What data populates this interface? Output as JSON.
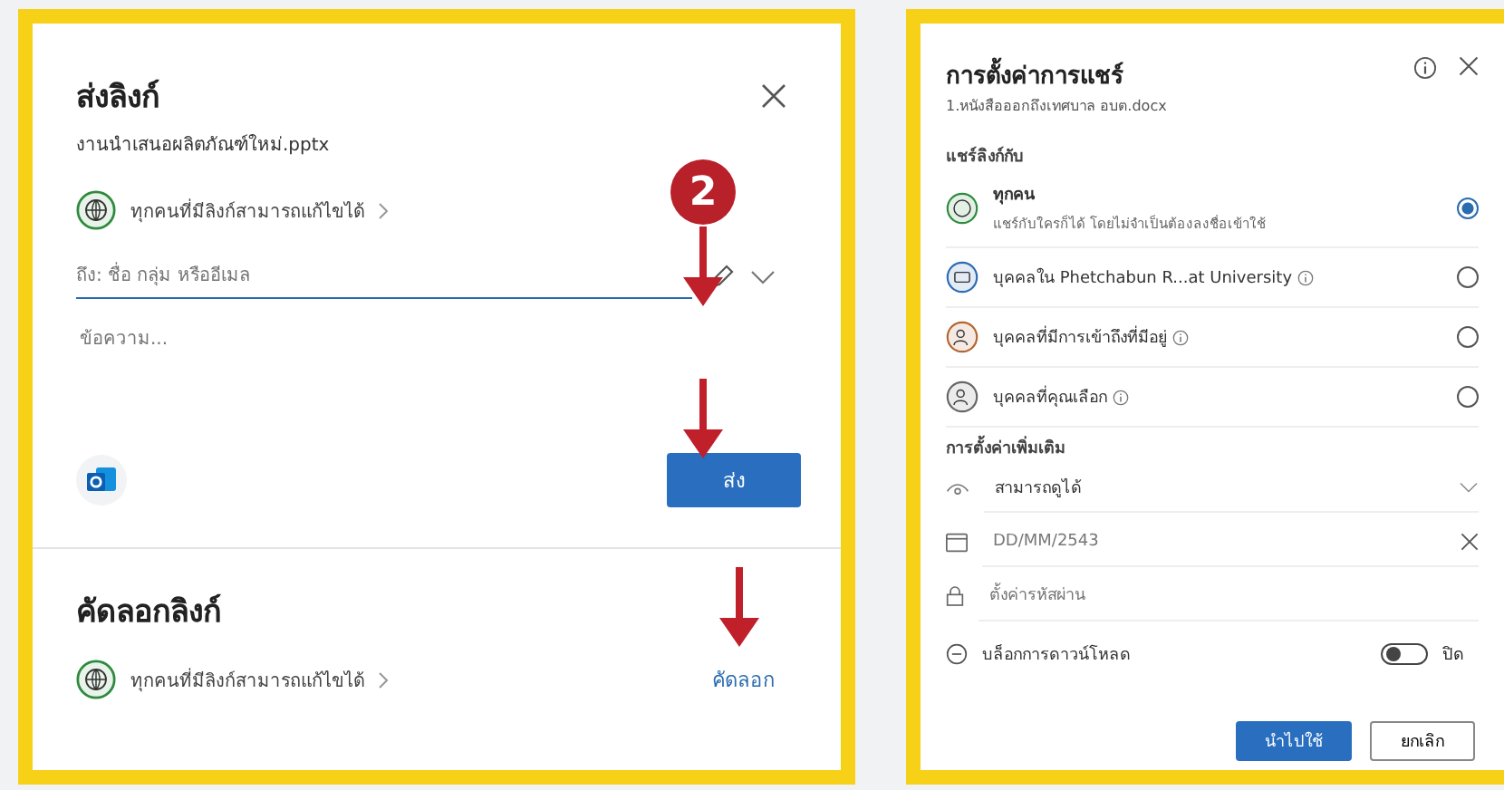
{
  "send_link": {
    "title": "ส่งลิงก์",
    "file_name": "งานนำเสนอผลิตภัณฑ์ใหม่.pptx",
    "permission": "ทุกคนที่มีลิงก์สามารถแก้ไขได้",
    "to_field": {
      "placeholder": "ถึง: ชื่อ กลุ่ม หรืออีเมล"
    },
    "message_field": {
      "placeholder": "ข้อความ..."
    },
    "send_button": "ส่ง"
  },
  "copy_link": {
    "title": "คัดลอกลิงก์",
    "permission": "ทุกคนที่มีลิงก์สามารถแก้ไขได้",
    "copy_button": "คัดลอก"
  },
  "annotation_badge": "2",
  "share_settings": {
    "title": "การตั้งค่าการแชร์",
    "file_name": "1.หนังสือออกถึงเทศบาล อบต.docx",
    "share_with_label": "แชร์ลิงก์กับ",
    "options": [
      {
        "label": "ทุกคน",
        "description": "แชร์กับใครก็ได้ โดยไม่จำเป็นต้องลงชื่อเข้าใช้",
        "info": false,
        "selected": true
      },
      {
        "label": "บุคคลใน Phetchabun R...at University",
        "info": true,
        "selected": false
      },
      {
        "label": "บุคคลที่มีการเข้าถึงที่มีอยู่",
        "info": true,
        "selected": false
      },
      {
        "label": "บุคคลที่คุณเลือก",
        "info": true,
        "selected": false
      }
    ],
    "more_settings_label": "การตั้งค่าเพิ่มเติม",
    "permission_value": "สามารถดูได้",
    "date_value": "DD/MM/2543",
    "password_placeholder": "ตั้งค่ารหัสผ่าน",
    "block_download": {
      "label": "บล็อกการดาวน์โหลด",
      "on": false,
      "state_text": "ปิด"
    },
    "apply_button": "นำไปใช้",
    "cancel_button": "ยกเลิก"
  }
}
